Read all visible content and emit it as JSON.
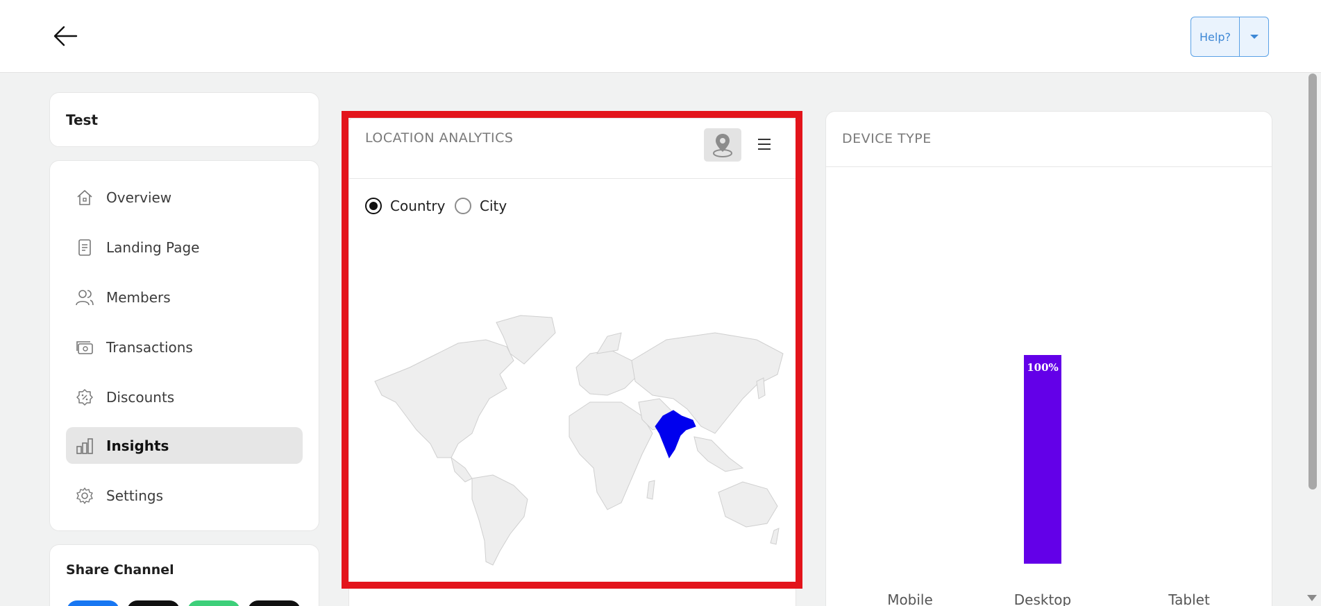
{
  "header": {
    "help_label": "Help?"
  },
  "sidebar": {
    "org_name": "Test",
    "items": [
      {
        "label": "Overview",
        "icon": "home-icon"
      },
      {
        "label": "Landing Page",
        "icon": "document-icon"
      },
      {
        "label": "Members",
        "icon": "users-icon"
      },
      {
        "label": "Transactions",
        "icon": "cash-icon"
      },
      {
        "label": "Discounts",
        "icon": "discount-badge-icon"
      },
      {
        "label": "Insights",
        "icon": "bar-chart-icon",
        "active": true
      },
      {
        "label": "Settings",
        "icon": "gear-icon"
      }
    ],
    "share_title": "Share Channel",
    "share_buttons": [
      {
        "color": "#1877f2"
      },
      {
        "color": "#111111"
      },
      {
        "color": "#3ecf7a"
      },
      {
        "color": "#111111"
      }
    ]
  },
  "location_analytics": {
    "title": "LOCATION ANALYTICS",
    "radio_options": [
      {
        "label": "Country",
        "selected": true
      },
      {
        "label": "City",
        "selected": false
      }
    ],
    "highlighted_country": "India",
    "highlight_color": "#0000ee"
  },
  "device_type": {
    "title": "DEVICE TYPE",
    "chart_data": {
      "type": "bar",
      "categories": [
        "Mobile",
        "Desktop",
        "Tablet"
      ],
      "values": [
        0,
        100,
        0
      ],
      "data_labels": [
        "",
        "100%",
        ""
      ],
      "ylim": [
        0,
        100
      ],
      "color": "#6300e8"
    }
  }
}
